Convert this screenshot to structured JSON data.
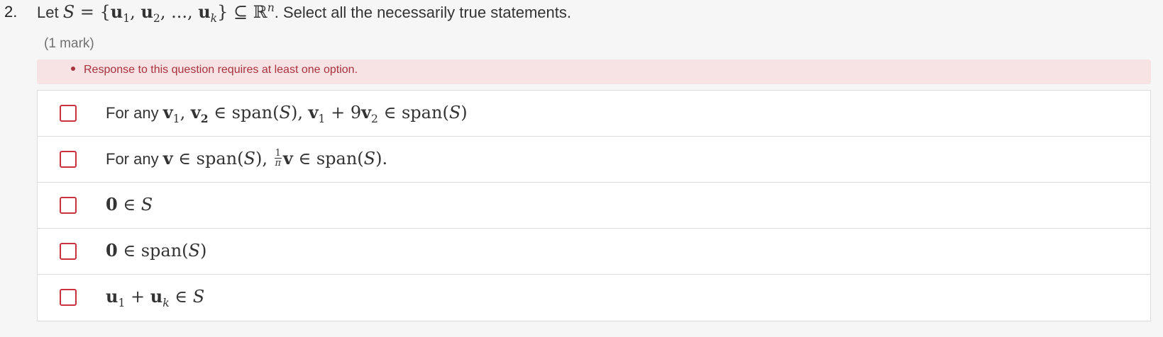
{
  "question": {
    "number": "2.",
    "prompt_text_1": "Let ",
    "prompt_text_2": ". Select all the necessarily true statements.",
    "mark": "(1 mark)"
  },
  "alert": {
    "message": "Response to this question requires at least one option."
  },
  "options": [
    {
      "prefix": "For any "
    },
    {
      "prefix": "For any "
    },
    {
      "prefix": ""
    },
    {
      "prefix": ""
    },
    {
      "prefix": ""
    }
  ],
  "colors": {
    "alert_bg": "#f7e2e4",
    "alert_text": "#a8323e",
    "checkbox_border": "#c8323f"
  }
}
